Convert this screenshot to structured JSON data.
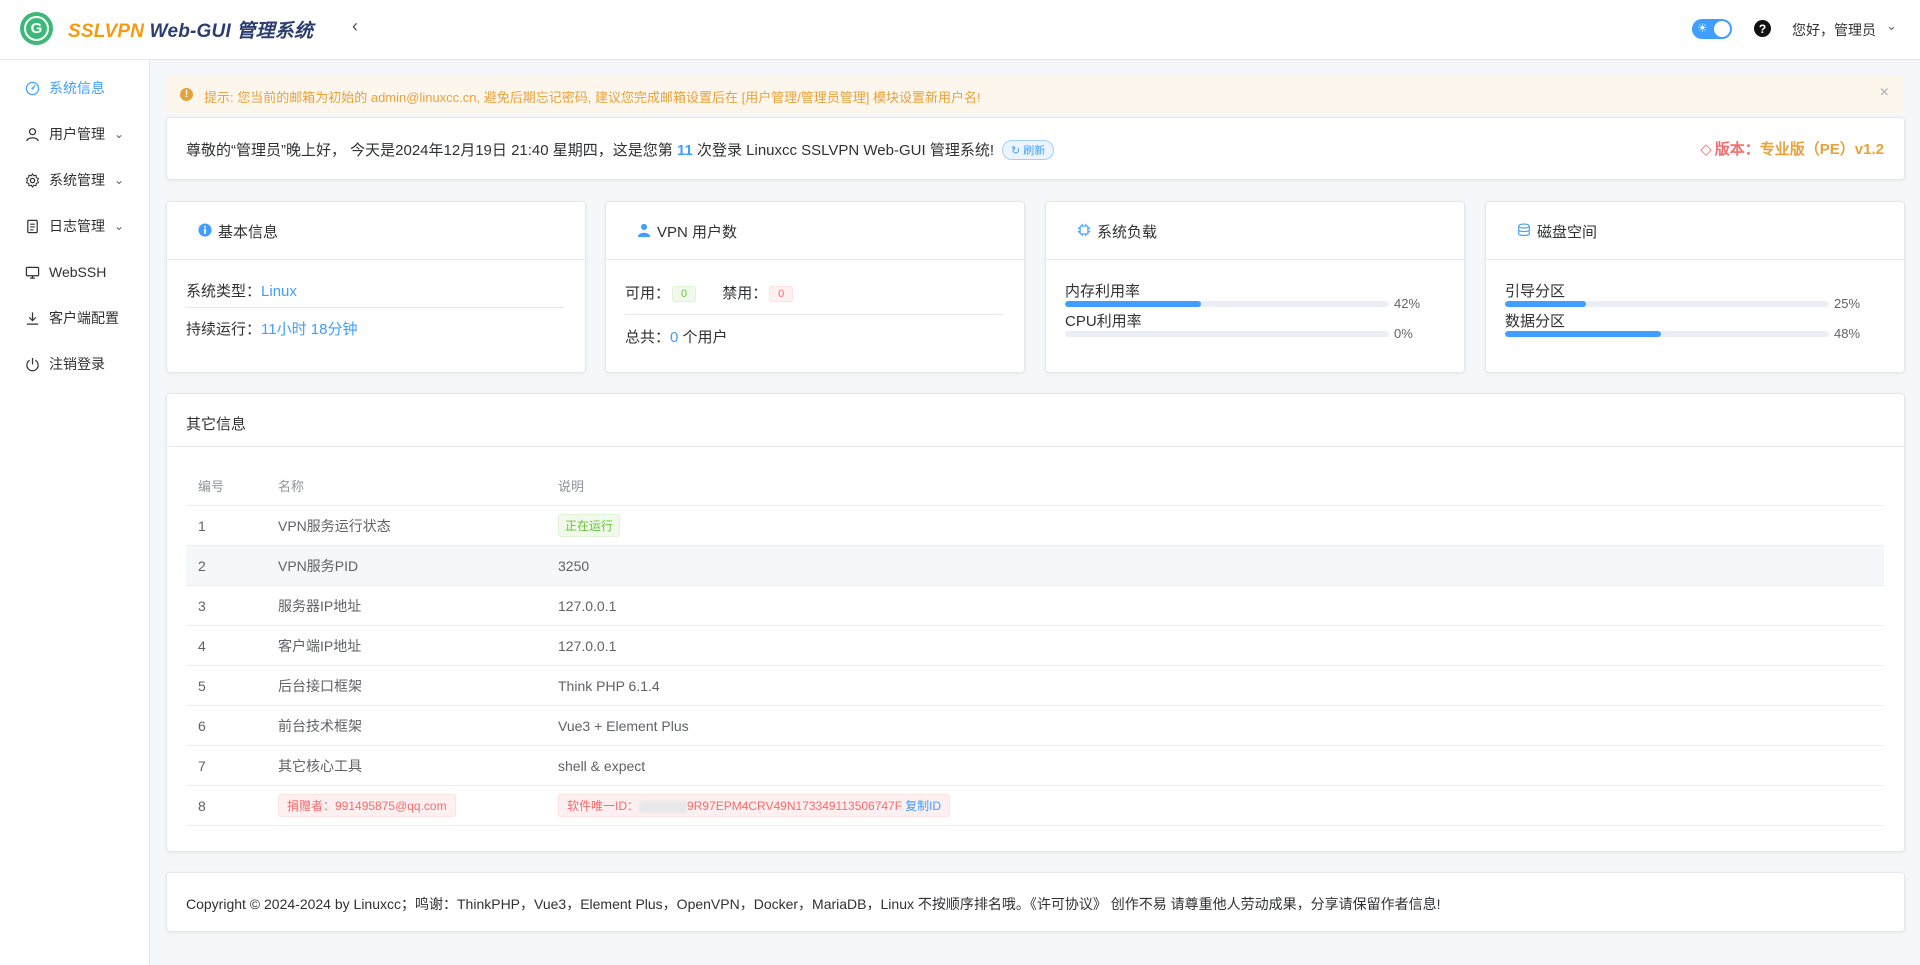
{
  "header": {
    "logo_letter": "G",
    "brand_part1": "SSLVPN",
    "brand_part2": " Web-GUI 管理系统",
    "collapse_icon": "chevron-left-icon",
    "greeting": "您好，管理员",
    "theme_icon": "sun-icon",
    "help_icon": "question-icon"
  },
  "sidebar": {
    "items": [
      {
        "label": "系统信息",
        "icon": "dashboard-icon",
        "active": true
      },
      {
        "label": "用户管理",
        "icon": "user-icon",
        "has_submenu": true
      },
      {
        "label": "系统管理",
        "icon": "gear-icon",
        "has_submenu": true
      },
      {
        "label": "日志管理",
        "icon": "document-icon",
        "has_submenu": true
      },
      {
        "label": "WebSSH",
        "icon": "monitor-icon"
      },
      {
        "label": "客户端配置",
        "icon": "download-icon"
      },
      {
        "label": "注销登录",
        "icon": "power-icon"
      }
    ]
  },
  "alert": {
    "text": "提示: 您当前的邮箱为初始的 admin@linuxcc.cn, 避免后期忘记密码, 建议您完成邮箱设置后在 [用户管理/管理员管理] 模块设置新用户名!",
    "color": "#e6a23c"
  },
  "greeting": {
    "prefix": "尊敬的“管理员”晚上好， 今天是2024年12月19日 21:40 星期四，这是您第 ",
    "count": "11",
    "suffix": " 次登录 Linuxcc SSLVPN Web-GUI 管理系统!",
    "refresh_label": "刷新",
    "version_label": "版本：",
    "version_value": "专业版（PE）v1.2"
  },
  "basic_info": {
    "title": "基本信息",
    "os_label": "系统类型：",
    "os_value": "Linux",
    "uptime_label": "持续运行：",
    "uptime_value": "11小时 18分钟"
  },
  "vpn_users": {
    "title": "VPN 用户数",
    "available_label": "可用：",
    "available_value": "0",
    "disabled_label": "禁用：",
    "disabled_value": "0",
    "total_label": "总共：",
    "total_value": "0",
    "total_unit": " 个用户"
  },
  "system_load": {
    "title": "系统负载",
    "memory_label": "内存利用率",
    "memory_pct": 42,
    "memory_text": "42%",
    "cpu_label": "CPU利用率",
    "cpu_pct": 0,
    "cpu_text": "0%"
  },
  "disk": {
    "title": "磁盘空间",
    "boot_label": "引导分区",
    "boot_pct": 25,
    "boot_text": "25%",
    "data_label": "数据分区",
    "data_pct": 48,
    "data_text": "48%"
  },
  "other_info": {
    "title": "其它信息",
    "columns": [
      "编号",
      "名称",
      "说明"
    ],
    "rows": [
      {
        "no": "1",
        "name": "VPN服务运行状态",
        "desc": "正在运行"
      },
      {
        "no": "2",
        "name": "VPN服务PID",
        "desc": "3250"
      },
      {
        "no": "3",
        "name": "服务器IP地址",
        "desc": "127.0.0.1"
      },
      {
        "no": "4",
        "name": "客户端IP地址",
        "desc": "127.0.0.1"
      },
      {
        "no": "5",
        "name": "后台接口框架",
        "desc": "Think PHP 6.1.4"
      },
      {
        "no": "6",
        "name": "前台技术框架",
        "desc": "Vue3 + Element Plus"
      },
      {
        "no": "7",
        "name": "其它核心工具",
        "desc": "shell & expect"
      },
      {
        "no": "8",
        "name": "捐赠者：991495875@qq.com",
        "desc_prefix": "软件唯一ID：",
        "desc_value": "9R97EPM4CRV49N173349113506747F",
        "copy_label": "复制ID"
      }
    ]
  },
  "footer": {
    "text": "Copyright © 2024-2024 by Linuxcc；鸣谢：ThinkPHP，Vue3，Element Plus，OpenVPN，Docker，MariaDB，Linux 不按顺序排名哦。《许可协议》 创作不易 请尊重他人劳动成果，分享请保留作者信息!"
  },
  "colors": {
    "primary": "#409eff",
    "success": "#67c23a",
    "warning": "#e6a23c",
    "danger": "#f56c6c"
  }
}
